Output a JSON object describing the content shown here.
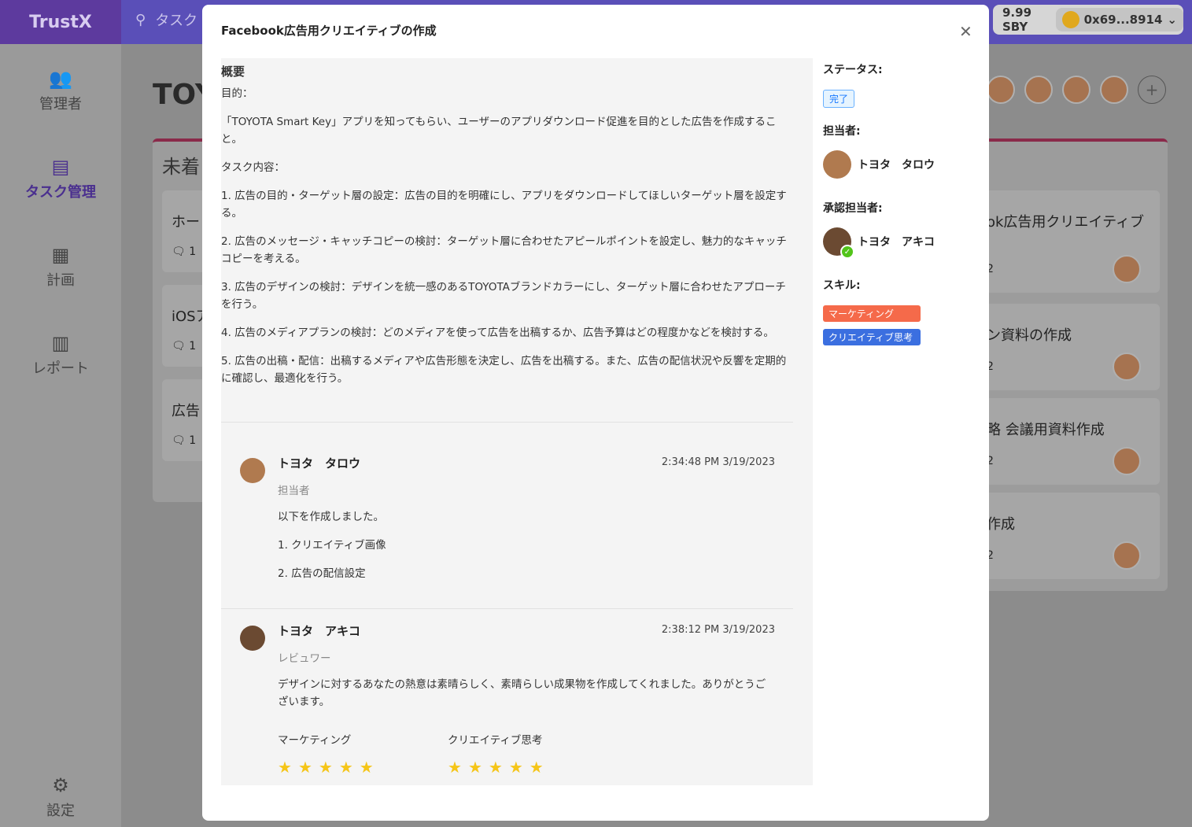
{
  "app": {
    "brand": "TrustX",
    "search_placeholder": "タスク"
  },
  "wallet": {
    "balance": "9.99 SBY",
    "address": "0x69...8914"
  },
  "sidebar": {
    "items": [
      {
        "label": "管理者",
        "icon": "users-icon"
      },
      {
        "label": "タスク管理",
        "icon": "server-icon"
      },
      {
        "label": "計画",
        "icon": "calendar-icon"
      },
      {
        "label": "レポート",
        "icon": "chart-icon"
      },
      {
        "label": "設定",
        "icon": "gear-icon"
      }
    ]
  },
  "background": {
    "page_title": "TOY",
    "column_title": "未着",
    "left_cards": [
      {
        "title": "ホー",
        "comments": "1"
      },
      {
        "title": "iOSア",
        "comments": "1"
      },
      {
        "title": "広告",
        "comments": "1"
      }
    ],
    "right_cards": [
      {
        "title": "ok広告用クリエイティブ",
        "count": "2"
      },
      {
        "title": "ン資料の作成",
        "count": "2"
      },
      {
        "title": "略 会議用資料作成",
        "count": "2"
      },
      {
        "title": "作成",
        "count": "2"
      }
    ]
  },
  "modal": {
    "title": "Facebook広告用クリエイティブの作成",
    "overview": {
      "heading": "概要",
      "purpose_label": "目的：",
      "purpose": "「TOYOTA Smart Key」アプリを知ってもらい、ユーザーのアプリダウンロード促進を目的とした広告を作成すること。",
      "tasks_label": "タスク内容：",
      "tasks": [
        "1. 広告の目的・ターゲット層の設定：広告の目的を明確にし、アプリをダウンロードしてほしいターゲット層を設定する。",
        "2. 広告のメッセージ・キャッチコピーの検討：ターゲット層に合わせたアピールポイントを設定し、魅力的なキャッチコピーを考える。",
        "3. 広告のデザインの検討：デザインを統一感のあるTOYOTAブランドカラーにし、ターゲット層に合わせたアプローチを行う。",
        "4. 広告のメディアプランの検討：どのメディアを使って広告を出稿するか、広告予算はどの程度かなどを検討する。",
        "5. 広告の出稿・配信：出稿するメディアや広告形態を決定し、広告を出稿する。また、広告の配信状況や反響を定期的に確認し、最適化を行う。"
      ]
    },
    "comments": [
      {
        "name": "トヨタ　タロウ",
        "time": "2:34:48 PM 3/19/2023",
        "role": "担当者",
        "lines": [
          "以下を作成しました。",
          "1. クリエイティブ画像",
          "2. 広告の配信設定"
        ]
      },
      {
        "name": "トヨタ　アキコ",
        "time": "2:38:12 PM 3/19/2023",
        "role": "レビュワー",
        "lines": [
          "デザインに対するあなたの熱意は素晴らしく、素晴らしい成果物を作成してくれました。ありがとうございます。"
        ],
        "ratings": [
          {
            "skill": "マーケティング",
            "stars": 5
          },
          {
            "skill": "クリエイティブ思考",
            "stars": 5
          }
        ]
      }
    ],
    "side": {
      "status_label": "ステータス:",
      "status": "完了",
      "assignee_label": "担当者:",
      "assignee": "トヨタ　タロウ",
      "approver_label": "承認担当者:",
      "approver": "トヨタ　アキコ",
      "skills_label": "スキル:",
      "skills": [
        "マーケティング",
        "クリエイティブ思考"
      ]
    },
    "colors": {
      "status_tag": "#1677ff",
      "skill_marketing": "#f56a4a",
      "skill_creative": "#3b6fe0",
      "star": "#f5c518"
    }
  }
}
